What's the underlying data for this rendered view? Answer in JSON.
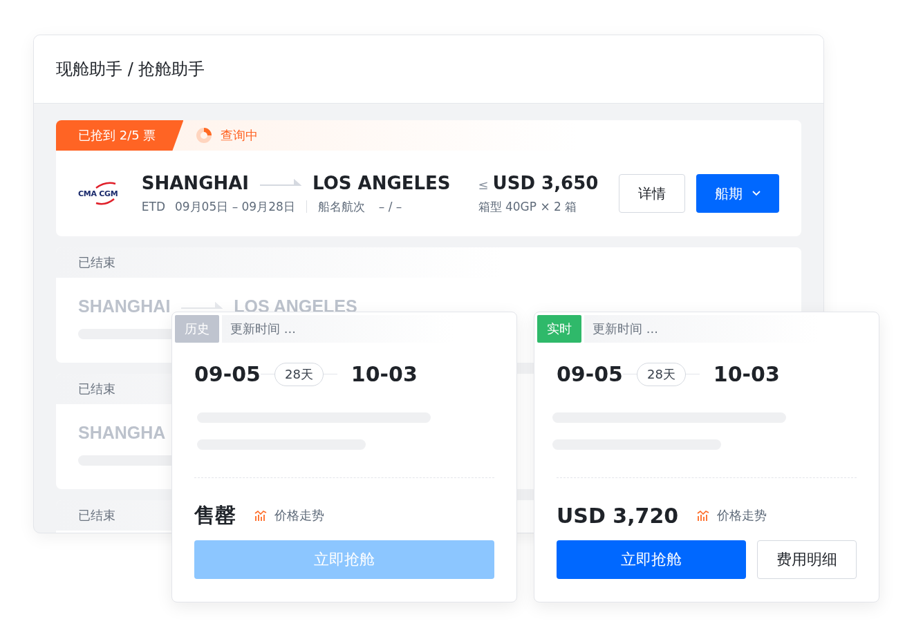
{
  "header": {
    "title": "现舱助手 / 抢舱助手"
  },
  "active_task": {
    "grabbed": "已抢到 2/5 票",
    "status": "查询中",
    "carrier_logo": "CMA CGM",
    "origin": "SHANGHAI",
    "destination": "LOS ANGELES",
    "etd_label": "ETD",
    "etd_range": "09月05日 – 09月28日",
    "vessel_label": "船名航次",
    "vessel_value": "– / –",
    "price_prefix": "≤",
    "price": "USD 3,650",
    "container": "箱型 40GP × 2 箱",
    "buttons": [
      {
        "label": "详情",
        "kind": "outline"
      },
      {
        "label": "船期",
        "kind": "dropdown"
      }
    ]
  },
  "ended_tasks": [
    {
      "status": "已结束",
      "origin": "SHANGHAI",
      "destination": "LOS ANGELES"
    },
    {
      "status": "已结束",
      "origin": "SHANGHA"
    },
    {
      "status": "已结束"
    }
  ],
  "schedule_cards": [
    {
      "tag": "历史",
      "kind": "history",
      "updated": "更新时间 ...",
      "depart": "09-05",
      "duration": "28天",
      "arrive": "10-03",
      "price": "售罄",
      "trend": "价格走势",
      "buttons": [
        {
          "label": "立即抢舱",
          "kind": "primary",
          "disabled": true
        }
      ]
    },
    {
      "tag": "实时",
      "kind": "live",
      "updated": "更新时间 ...",
      "depart": "09-05",
      "duration": "28天",
      "arrive": "10-03",
      "price": "USD 3,720",
      "trend": "价格走势",
      "buttons": [
        {
          "label": "立即抢舱",
          "kind": "primary",
          "disabled": false
        },
        {
          "label": "费用明细",
          "kind": "outline",
          "disabled": false
        }
      ]
    }
  ]
}
